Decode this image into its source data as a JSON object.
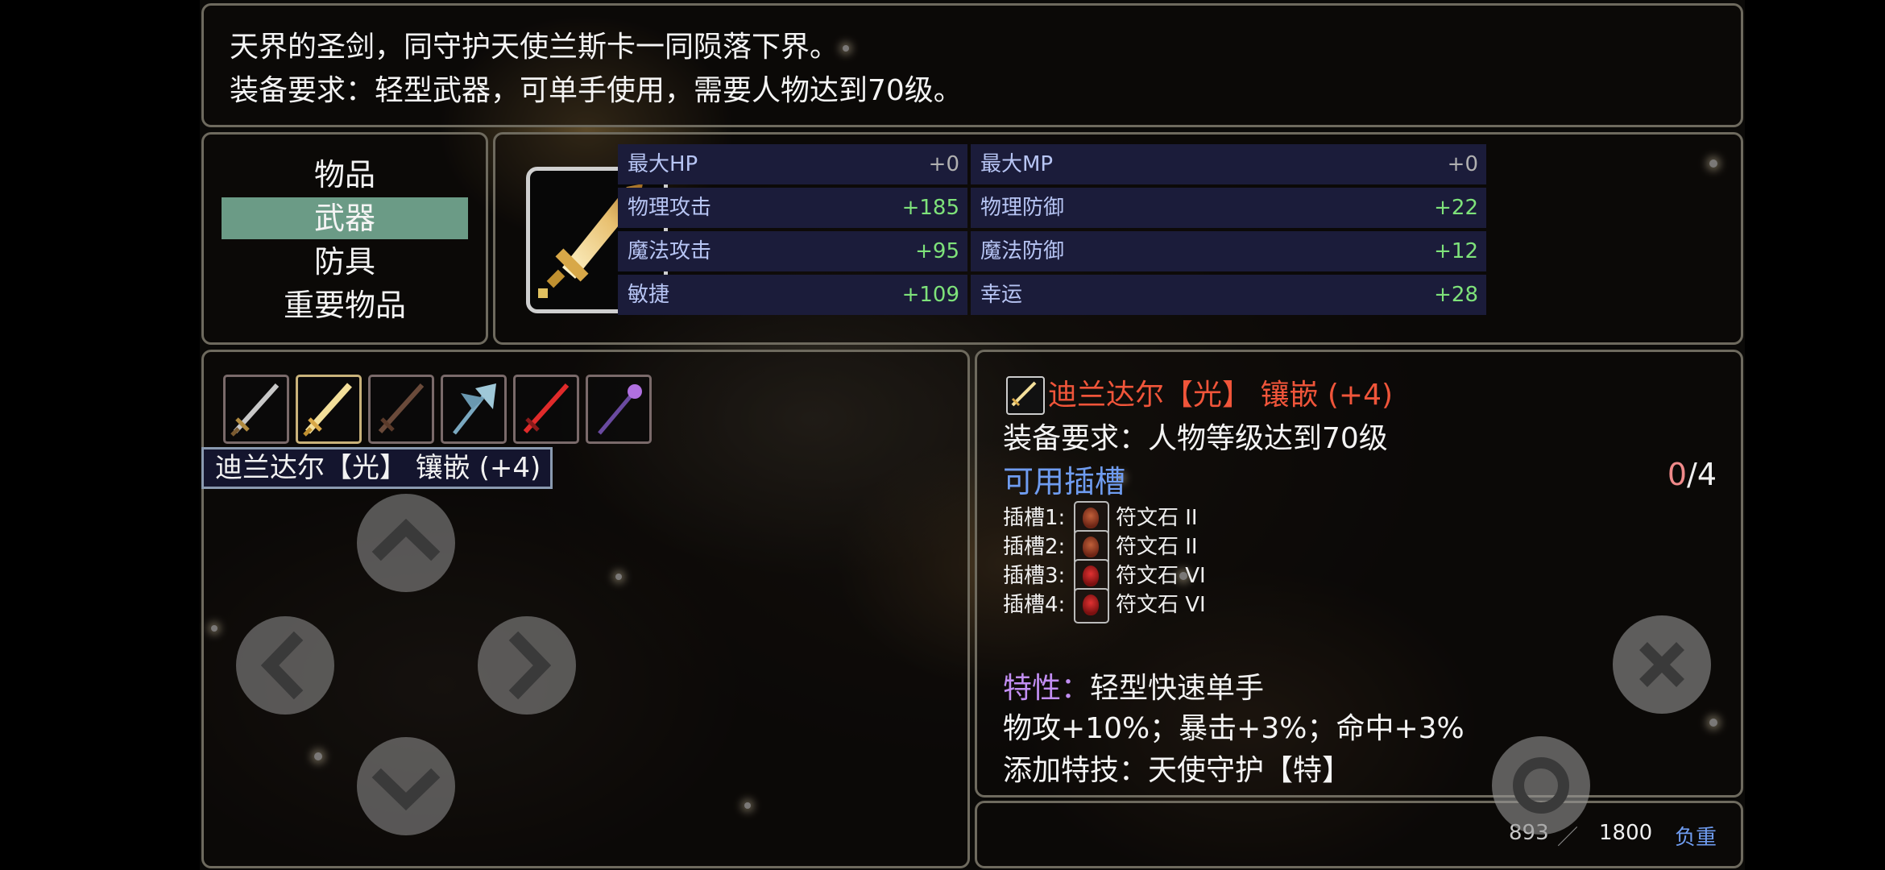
{
  "description": {
    "line1": "天界的圣剑，同守护天使兰斯卡一同陨落下界。",
    "line2": "装备要求：轻型武器，可单手使用，需要人物达到70级。"
  },
  "menu": {
    "items": [
      {
        "label": "物品",
        "active": false
      },
      {
        "label": "武器",
        "active": true
      },
      {
        "label": "防具",
        "active": false
      },
      {
        "label": "重要物品",
        "active": false
      }
    ]
  },
  "stats": {
    "left": [
      {
        "name": "最大HP",
        "value": "+0"
      },
      {
        "name": "物理攻击",
        "value": "+185"
      },
      {
        "name": "魔法攻击",
        "value": "+95"
      },
      {
        "name": "敏捷",
        "value": "+109"
      }
    ],
    "right": [
      {
        "name": "最大MP",
        "value": "+0"
      },
      {
        "name": "物理防御",
        "value": "+22"
      },
      {
        "name": "魔法防御",
        "value": "+12"
      },
      {
        "name": "幸运",
        "value": "+28"
      }
    ]
  },
  "inventory": {
    "weapons": [
      {
        "icon": "sword-icon"
      },
      {
        "icon": "holy-sword-icon"
      },
      {
        "icon": "dark-sword-icon"
      },
      {
        "icon": "axe-icon"
      },
      {
        "icon": "red-sword-icon"
      },
      {
        "icon": "staff-icon"
      }
    ],
    "selected_index": 1,
    "tooltip": "迪兰达尔【光】 镶嵌 (+4)"
  },
  "detail": {
    "name": "迪兰达尔【光】 镶嵌 (+4)",
    "requirement": "装备要求：人物等级达到70级",
    "slots_title": "可用插槽",
    "slots_used": "0",
    "slots_total": "/4",
    "sockets": [
      {
        "label": "插槽1:",
        "gem": "符文石 II"
      },
      {
        "label": "插槽2:",
        "gem": "符文石 II"
      },
      {
        "label": "插槽3:",
        "gem": "符文石 VI"
      },
      {
        "label": "插槽4:",
        "gem": "符文石 VI"
      }
    ],
    "trait_label": "特性：",
    "trait_value": "轻型快速单手",
    "bonus": "物攻+10%；暴击+3%；命中+3%",
    "skill": "添加特技：天使守护【特】"
  },
  "weight": {
    "current": "893",
    "max": "1800",
    "label": "负重"
  },
  "colors": {
    "menu_active": "#6b9b86",
    "stat_bg": "#1b1c3a",
    "stat_name": "#b7c5f4",
    "stat_positive": "#7ee27a",
    "item_name": "#f0553a",
    "slots_title": "#6f9cf0",
    "trait_label": "#c28ef3"
  }
}
